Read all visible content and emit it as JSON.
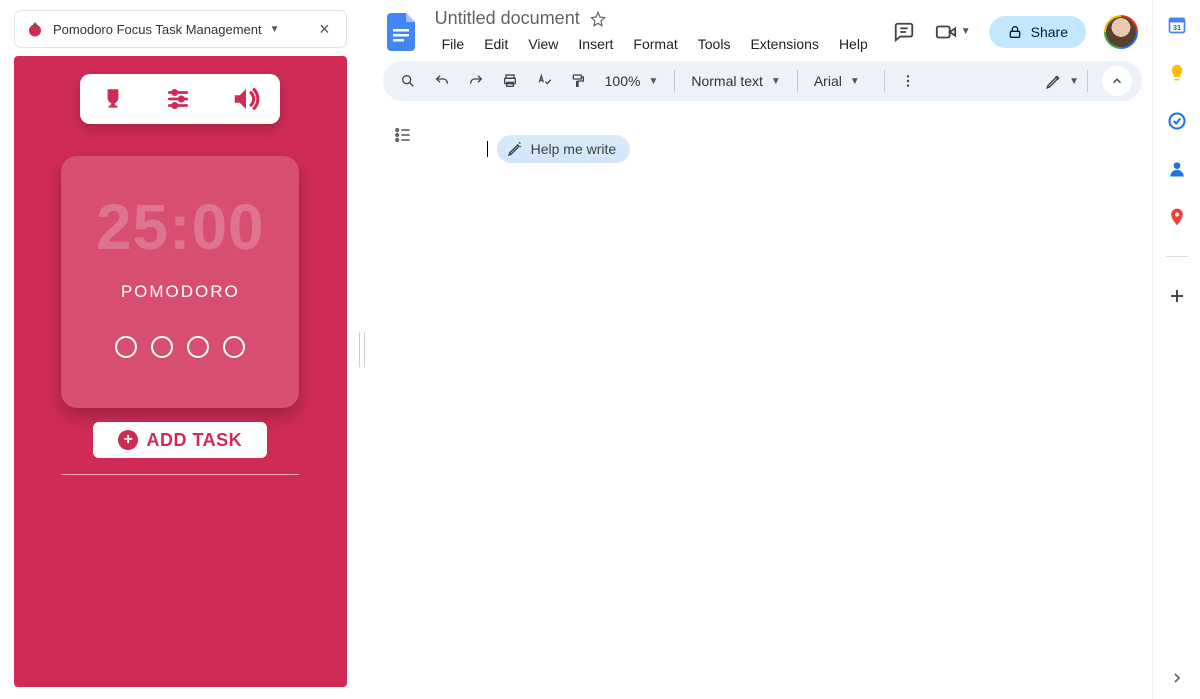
{
  "extension": {
    "title": "Pomodoro Focus Task Management",
    "close": "×",
    "dropdown": "▼"
  },
  "pomodoro": {
    "timer_value": "25:00",
    "timer_label": "POMODORO",
    "add_task_label": "ADD TASK"
  },
  "docs": {
    "title": "Untitled document",
    "menus": [
      "File",
      "Edit",
      "View",
      "Insert",
      "Format",
      "Tools",
      "Extensions",
      "Help"
    ],
    "zoom": "100%",
    "style": "Normal text",
    "font": "Arial",
    "share_label": "Share",
    "help_write": "Help me write"
  }
}
